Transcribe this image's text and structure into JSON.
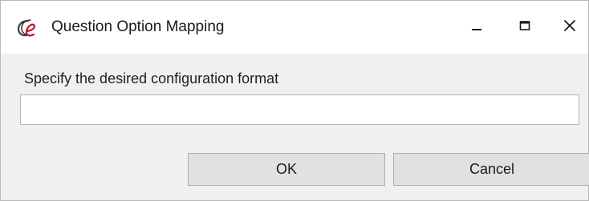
{
  "window": {
    "title": "Question Option Mapping",
    "app_icon": "ce-logo-icon",
    "controls": {
      "minimize": "minimize-icon",
      "maximize": "maximize-icon",
      "close": "close-icon"
    }
  },
  "form": {
    "prompt": "Specify the desired configuration format",
    "input_value": "",
    "input_placeholder": ""
  },
  "buttons": {
    "ok_label": "OK",
    "cancel_label": "Cancel"
  },
  "colors": {
    "logo_dark": "#3b3b3b",
    "logo_red": "#c8102e",
    "dialog_background": "#f0f0f0",
    "button_background": "#e1e1e1",
    "input_border": "#a9b7c6"
  }
}
